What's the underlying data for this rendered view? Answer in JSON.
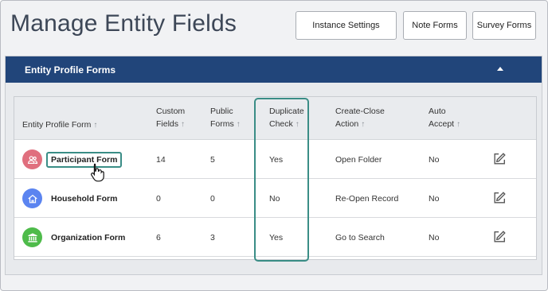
{
  "header": {
    "title": "Manage Entity Fields",
    "buttons": {
      "instance_settings": "Instance Settings",
      "note_forms": "Note Forms",
      "survey_forms": "Survey Forms"
    }
  },
  "panel": {
    "title": "Entity Profile Forms",
    "columns": {
      "form_line1": "Entity Profile Form",
      "custom_line1": "Custom",
      "custom_line2": "Fields",
      "public_line1": "Public",
      "public_line2": "Forms",
      "dup_line1": "Duplicate",
      "dup_line2": "Check",
      "action_line1": "Create-Close",
      "action_line2": "Action",
      "auto_line1": "Auto",
      "auto_line2": "Accept",
      "sort_glyph": "↑"
    },
    "rows": [
      {
        "name": "Participant Form",
        "custom_fields": "14",
        "public_forms": "5",
        "duplicate_check": "Yes",
        "create_close_action": "Open Folder",
        "auto_accept": "No",
        "icon": "people-icon",
        "icon_color": "#e06f7e"
      },
      {
        "name": "Household Form",
        "custom_fields": "0",
        "public_forms": "0",
        "duplicate_check": "No",
        "create_close_action": "Re-Open Record",
        "auto_accept": "No",
        "icon": "house-icon",
        "icon_color": "#5b84f0"
      },
      {
        "name": "Organization Form",
        "custom_fields": "6",
        "public_forms": "3",
        "duplicate_check": "Yes",
        "create_close_action": "Go to Search",
        "auto_accept": "No",
        "icon": "building-icon",
        "icon_color": "#4ebb4a"
      }
    ]
  },
  "colors": {
    "panel_header": "#21457a",
    "highlight": "#3a8d86",
    "title_text": "#3d4757"
  }
}
